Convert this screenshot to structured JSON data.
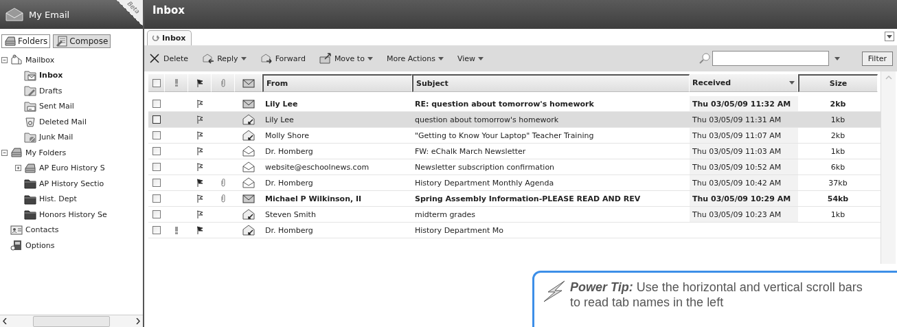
{
  "sidebar": {
    "title": "My Email",
    "badge": "Beta",
    "buttons": [
      {
        "label": "Folders",
        "selected": true
      },
      {
        "label": "Compose",
        "selected": false
      }
    ],
    "tree": [
      {
        "label": "Mailbox",
        "expanded": true,
        "selected": false,
        "children": [
          {
            "label": "Inbox",
            "selected": true
          },
          {
            "label": "Drafts",
            "selected": false
          },
          {
            "label": "Sent Mail",
            "selected": false
          },
          {
            "label": "Deleted Mail",
            "selected": false
          },
          {
            "label": "Junk Mail",
            "selected": false
          }
        ]
      },
      {
        "label": "My Folders",
        "expanded": true,
        "selected": false,
        "children": [
          {
            "label": "AP Euro History S",
            "expanded": false,
            "selected": false
          },
          {
            "label": "AP History Sectio",
            "selected": false
          },
          {
            "label": "Hist. Dept",
            "selected": false
          },
          {
            "label": "Honors History Se",
            "selected": false
          }
        ]
      },
      {
        "label": "Contacts",
        "selected": false
      },
      {
        "label": "Options",
        "selected": false
      }
    ]
  },
  "header": {
    "title": "Inbox"
  },
  "tabs": [
    {
      "label": "Inbox",
      "selected": true
    }
  ],
  "toolbar": {
    "actions": [
      {
        "label": "Delete",
        "menu": false
      },
      {
        "label": "Reply",
        "menu": true
      },
      {
        "label": "Forward",
        "menu": false
      },
      {
        "label": "Move to",
        "menu": true
      },
      {
        "label": "More Actions",
        "menu": true
      },
      {
        "label": "View",
        "menu": true
      }
    ],
    "filter_button": "Filter"
  },
  "table": {
    "select_all_checked": false,
    "columns": [
      "From",
      "Subject",
      "Received",
      "Size"
    ],
    "rows": [
      {
        "from": "Lily Lee",
        "subject": "RE: question about tomorrow's homework",
        "received": "Thu 03/05/09 11:32 AM",
        "size": "2kb",
        "unread": true,
        "replied": false,
        "selected": false,
        "flagged": false,
        "attachment": false,
        "important": false
      },
      {
        "from": "Lily Lee",
        "subject": "question about tomorrow's homework",
        "received": "Thu 03/05/09 11:31 AM",
        "size": "1kb",
        "unread": false,
        "replied": true,
        "selected": true,
        "flagged": false,
        "attachment": false,
        "important": false
      },
      {
        "from": "Molly Shore",
        "subject": "\"Getting to Know Your Laptop\" Teacher Training",
        "received": "Thu 03/05/09 11:07 AM",
        "size": "2kb",
        "unread": false,
        "replied": true,
        "selected": false,
        "flagged": false,
        "attachment": false,
        "important": false
      },
      {
        "from": "Dr. Homberg",
        "subject": "FW: eChalk March Newsletter",
        "received": "Thu 03/05/09 11:03 AM",
        "size": "1kb",
        "unread": false,
        "replied": false,
        "selected": false,
        "flagged": false,
        "attachment": false,
        "important": false
      },
      {
        "from": "website@eschoolnews.com",
        "subject": "Newsletter subscription confirmation",
        "received": "Thu 03/05/09 10:52 AM",
        "size": "6kb",
        "unread": false,
        "replied": false,
        "selected": false,
        "flagged": false,
        "attachment": false,
        "important": false
      },
      {
        "from": "Dr. Homberg",
        "subject": "History Department Monthly Agenda",
        "received": "Thu 03/05/09 10:42 AM",
        "size": "37kb",
        "unread": false,
        "replied": false,
        "selected": false,
        "flagged": true,
        "attachment": true,
        "important": false
      },
      {
        "from": "Michael P Wilkinson, II",
        "subject": "Spring Assembly Information-PLEASE READ AND REV",
        "received": "Thu 03/05/09 10:29 AM",
        "size": "54kb",
        "unread": true,
        "replied": false,
        "selected": false,
        "flagged": false,
        "attachment": true,
        "important": false
      },
      {
        "from": "Steven Smith",
        "subject": "midterm grades",
        "received": "Thu 03/05/09 10:23 AM",
        "size": "1kb",
        "unread": false,
        "replied": true,
        "selected": false,
        "flagged": false,
        "attachment": false,
        "important": false
      },
      {
        "from": "Dr. Homberg",
        "subject": "History Department Mo",
        "unread": false,
        "replied": true,
        "selected": false,
        "flagged": true,
        "attachment": false,
        "important": true
      }
    ]
  },
  "tip": {
    "text": "**Power Tip:** Use the horizontal and vertical scroll bars to read tab names in the left"
  }
}
